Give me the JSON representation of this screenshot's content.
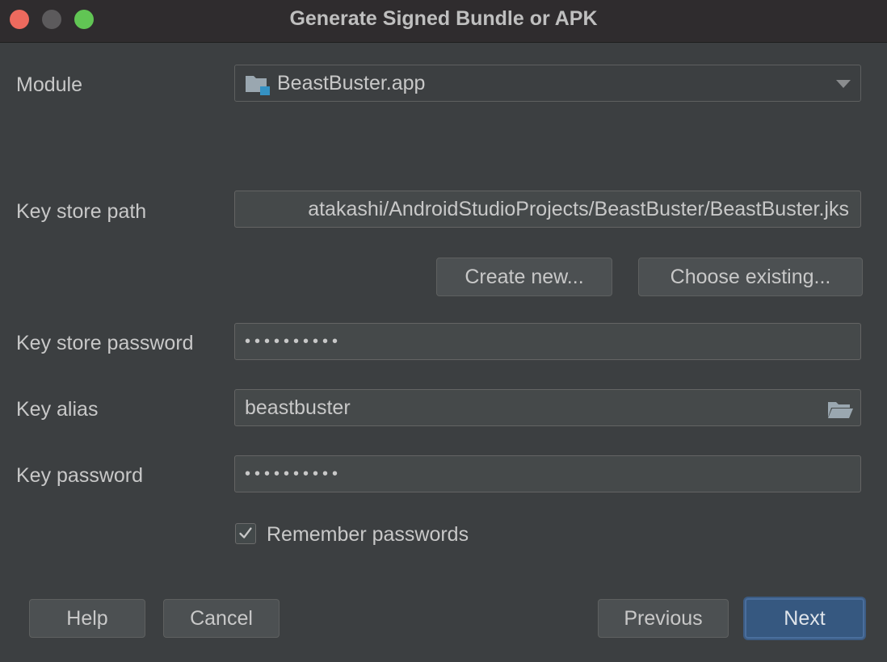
{
  "window": {
    "title": "Generate Signed Bundle or APK"
  },
  "form": {
    "module": {
      "label": "Module",
      "value": "BeastBuster.app"
    },
    "key_store_path": {
      "label": "Key store path",
      "value": "atakashi/AndroidStudioProjects/BeastBuster/BeastBuster.jks"
    },
    "create_new_label": "Create new...",
    "choose_existing_label": "Choose existing...",
    "key_store_password": {
      "label": "Key store password",
      "value": "••••••••••"
    },
    "key_alias": {
      "label": "Key alias",
      "value": "beastbuster"
    },
    "key_password": {
      "label": "Key password",
      "value": "••••••••••"
    },
    "remember_passwords": {
      "label": "Remember passwords",
      "checked": true,
      "check_glyph": "✓"
    }
  },
  "footer": {
    "help_label": "Help",
    "cancel_label": "Cancel",
    "previous_label": "Previous",
    "next_label": "Next"
  },
  "icons": {
    "module": "module-folder-icon",
    "dropdown": "chevron-down-icon",
    "browse": "open-folder-icon",
    "checkbox": "checkmark-icon"
  },
  "colors": {
    "window_bg": "#3c3f41",
    "titlebar_bg": "#2f2c2e",
    "close": "#ed6a5e",
    "minimize": "#5c5a5c",
    "maximize": "#61c554",
    "field_bg": "#45494a",
    "primary_button": "#365880",
    "module_icon_accent": "#3592c4"
  }
}
